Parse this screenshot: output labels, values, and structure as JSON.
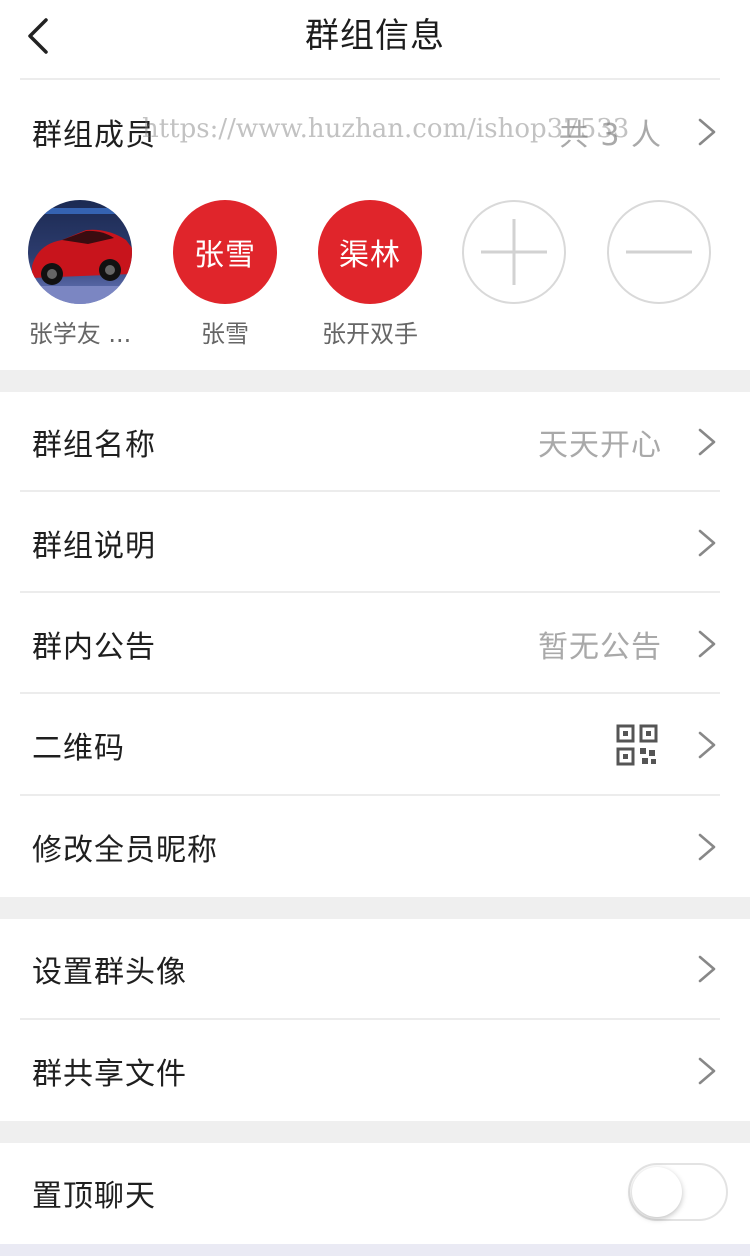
{
  "header": {
    "title": "群组信息",
    "back_icon": "chevron-left-icon"
  },
  "watermark": "https://www.huzhan.com/ishop37533",
  "members_section": {
    "label": "群组成员",
    "count": "共 3 人",
    "members": [
      {
        "name": "张学友 ...",
        "avatar_text": "",
        "avatar": "car-photo"
      },
      {
        "name": "张雪",
        "avatar_text": "张雪"
      },
      {
        "name": "张开双手",
        "avatar_text": "渠林"
      }
    ],
    "add_icon": "plus-icon",
    "remove_icon": "minus-icon"
  },
  "settings_group_1": [
    {
      "label": "群组名称",
      "value": "天天开心"
    },
    {
      "label": "群组说明",
      "value": ""
    },
    {
      "label": "群内公告",
      "value": "暂无公告"
    },
    {
      "label": "二维码",
      "value_icon": "qr-code-icon"
    },
    {
      "label": "修改全员昵称",
      "value": ""
    }
  ],
  "settings_group_2": [
    {
      "label": "设置群头像"
    },
    {
      "label": "群共享文件"
    }
  ],
  "pin_chat": {
    "label": "置顶聊天",
    "enabled": false
  },
  "colors": {
    "accent_red": "#e0252b",
    "divider": "#ececec",
    "section_gap": "#efefef",
    "muted_text": "#a9a9a9"
  }
}
